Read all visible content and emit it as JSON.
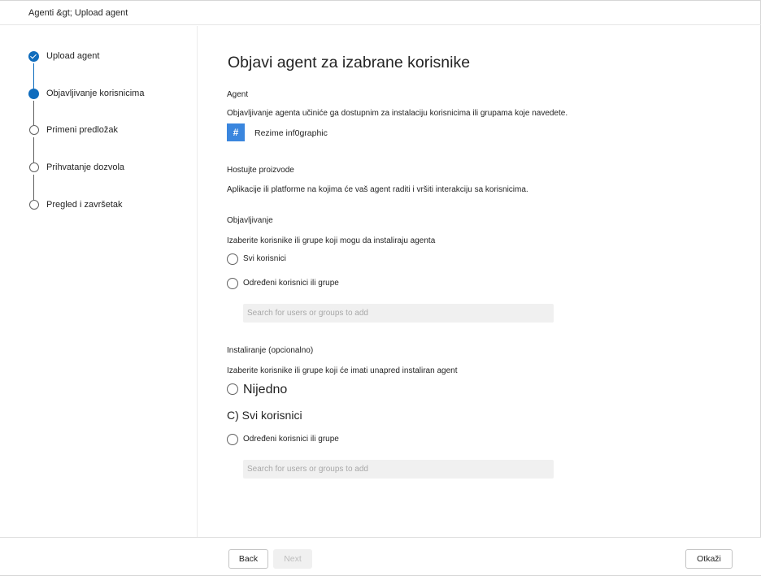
{
  "header": {
    "breadcrumb": "Agenti &gt; Upload agent"
  },
  "steps": [
    {
      "label": "Upload agent",
      "state": "done"
    },
    {
      "label": "Objavljivanje korisnicima",
      "state": "current"
    },
    {
      "label": "Primeni predložak",
      "state": "todo"
    },
    {
      "label": "Prihvatanje dozvola",
      "state": "todo"
    },
    {
      "label": "Pregled i završetak",
      "state": "todo"
    }
  ],
  "main": {
    "title": "Objavi agent za izabrane korisnike",
    "agent_section": {
      "heading": "Agent",
      "description": "Objavljivanje agenta učiniće ga dostupnim za instalaciju korisnicima ili grupama koje navedete.",
      "badge_symbol": "#",
      "agent_name": "Rezime inf0graphic"
    },
    "host_section": {
      "heading": "Hostujte proizvode",
      "description": "Aplikacije ili platforme na kojima će vaš agent raditi i vršiti interakciju sa korisnicima."
    },
    "publish_section": {
      "heading": "Objavljivanje",
      "description": "Izaberite korisnike ili grupe koji mogu da instaliraju agenta",
      "option_all": "Svi korisnici",
      "option_specific": "Određeni korisnici ili grupe",
      "search_placeholder": "Search for users or groups to add"
    },
    "install_section": {
      "heading": "Instaliranje (opcionalno)",
      "description": "Izaberite korisnike ili grupe koji će imati unapred instaliran agent",
      "option_none": "Nijedno",
      "option_all": "C) Svi korisnici",
      "option_specific": "Određeni korisnici ili grupe",
      "search_placeholder": "Search for users or groups to add"
    }
  },
  "footer": {
    "back_label": "Back",
    "next_label": "Next",
    "cancel_label": "Otkaži"
  },
  "colors": {
    "accent": "#0f6cbd",
    "badge": "#3a86de"
  }
}
